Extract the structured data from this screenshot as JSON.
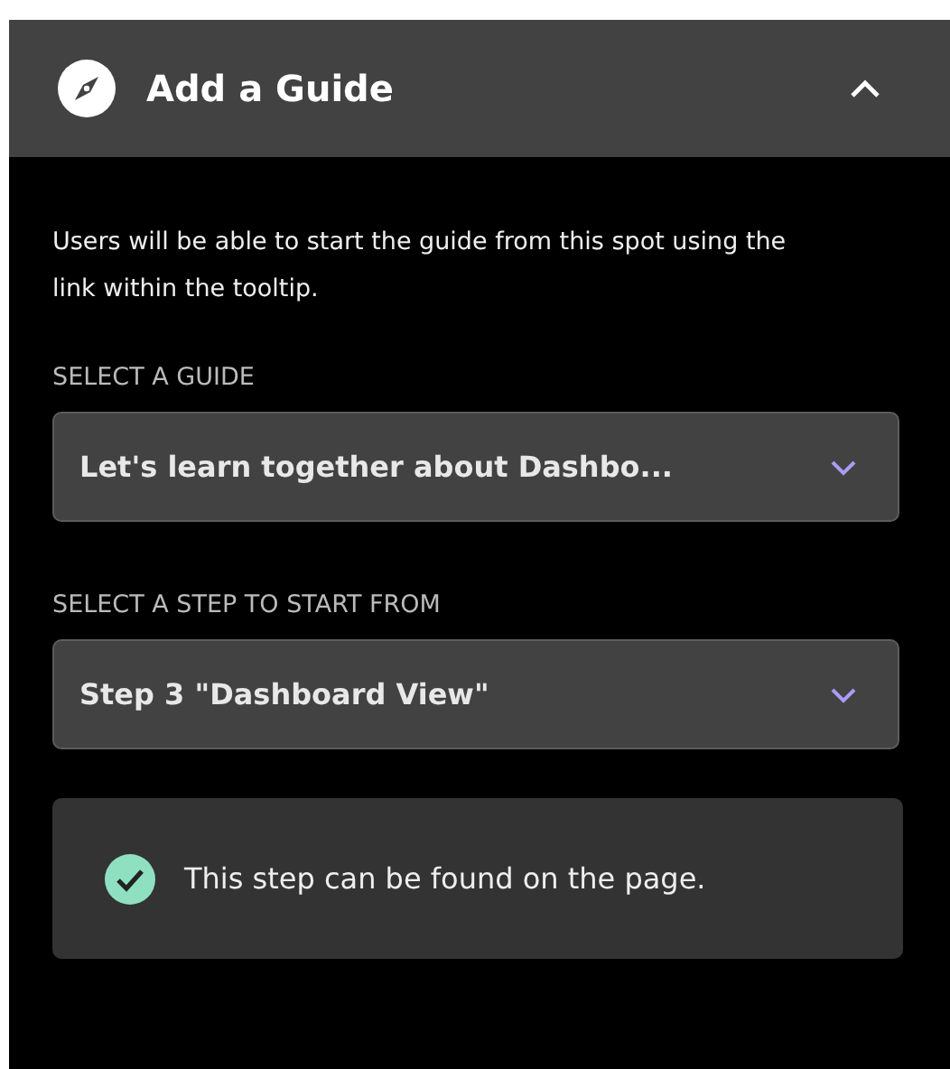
{
  "panel": {
    "title": "Add a Guide",
    "expanded": true
  },
  "description": "Users will be able to start the guide from this spot using the link within the tooltip.",
  "fields": [
    {
      "label": "SELECT A GUIDE",
      "value": "Let's learn together about Dashbo..."
    },
    {
      "label": "SELECT A STEP TO START FROM",
      "value": "Step 3 \"Dashboard View\""
    }
  ],
  "notice": {
    "kind": "success",
    "text": "This step can be found on the page."
  }
}
